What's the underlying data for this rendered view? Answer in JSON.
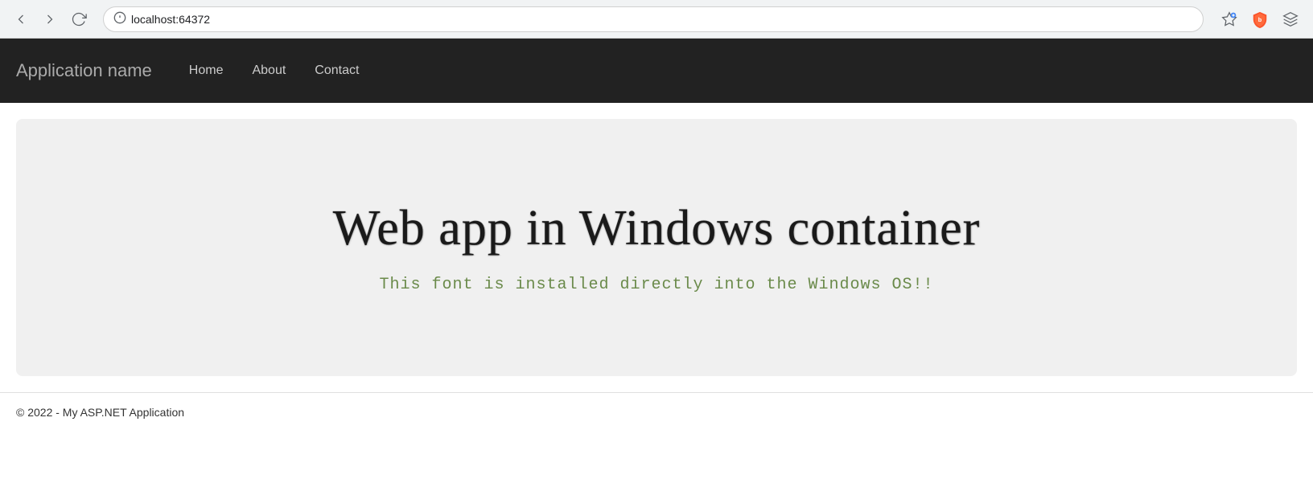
{
  "browser": {
    "url": "localhost:64372",
    "back_label": "←",
    "forward_label": "→",
    "reload_label": "↻"
  },
  "navbar": {
    "brand": "Application name",
    "links": [
      {
        "label": "Home",
        "href": "#"
      },
      {
        "label": "About",
        "href": "#"
      },
      {
        "label": "Contact",
        "href": "#"
      }
    ]
  },
  "hero": {
    "title": "Web app in Windows container",
    "subtitle": "This font is installed directly into the Windows OS!!"
  },
  "footer": {
    "text": "© 2022 - My ASP.NET Application"
  }
}
